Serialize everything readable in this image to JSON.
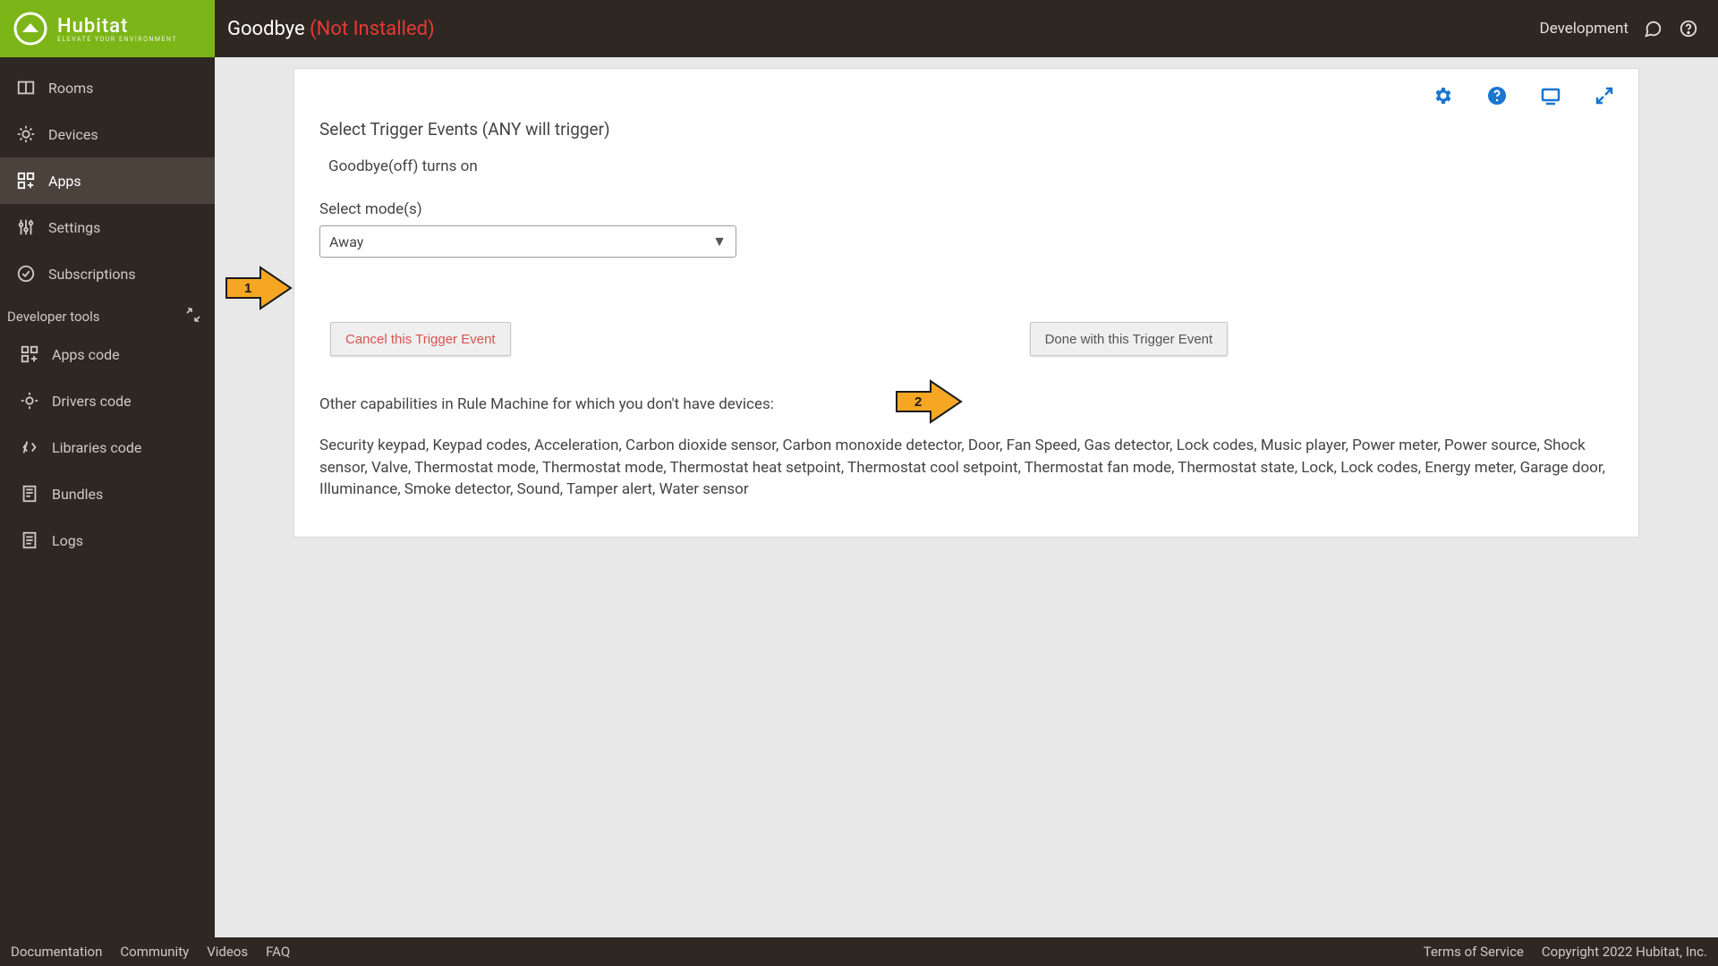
{
  "brand": {
    "name": "Hubitat",
    "tagline": "ELEVATE YOUR ENVIRONMENT"
  },
  "header": {
    "title": "Goodbye",
    "status": "(Not Installed)",
    "environment": "Development"
  },
  "sidebar": {
    "items": [
      {
        "label": "Rooms"
      },
      {
        "label": "Devices"
      },
      {
        "label": "Apps"
      },
      {
        "label": "Settings"
      },
      {
        "label": "Subscriptions"
      }
    ],
    "dev_header": "Developer tools",
    "dev_items": [
      {
        "label": "Apps code"
      },
      {
        "label": "Drivers code"
      },
      {
        "label": "Libraries code"
      },
      {
        "label": "Bundles"
      },
      {
        "label": "Logs"
      }
    ]
  },
  "panel": {
    "section_title": "Select Trigger Events (ANY will trigger)",
    "trigger_summary": "Goodbye(off) turns on",
    "mode_label": "Select mode(s)",
    "mode_value": "Away",
    "cancel_label": "Cancel this Trigger Event",
    "done_label": "Done with this Trigger Event",
    "other_caps_label": "Other capabilities in Rule Machine for which you don't have devices:",
    "other_caps_list": "Security keypad, Keypad codes, Acceleration, Carbon dioxide sensor, Carbon monoxide detector, Door, Fan Speed, Gas detector, Lock codes, Music player, Power meter, Power source, Shock sensor, Valve, Thermostat mode, Thermostat mode, Thermostat heat setpoint, Thermostat cool setpoint, Thermostat fan mode, Thermostat state, Lock, Lock codes, Energy meter, Garage door, Illuminance, Smoke detector, Sound, Tamper alert, Water sensor"
  },
  "annotations": {
    "arrow1": "1",
    "arrow2": "2"
  },
  "footer": {
    "links": [
      "Documentation",
      "Community",
      "Videos",
      "FAQ"
    ],
    "tos": "Terms of Service",
    "copyright": "Copyright 2022 Hubitat, Inc."
  }
}
